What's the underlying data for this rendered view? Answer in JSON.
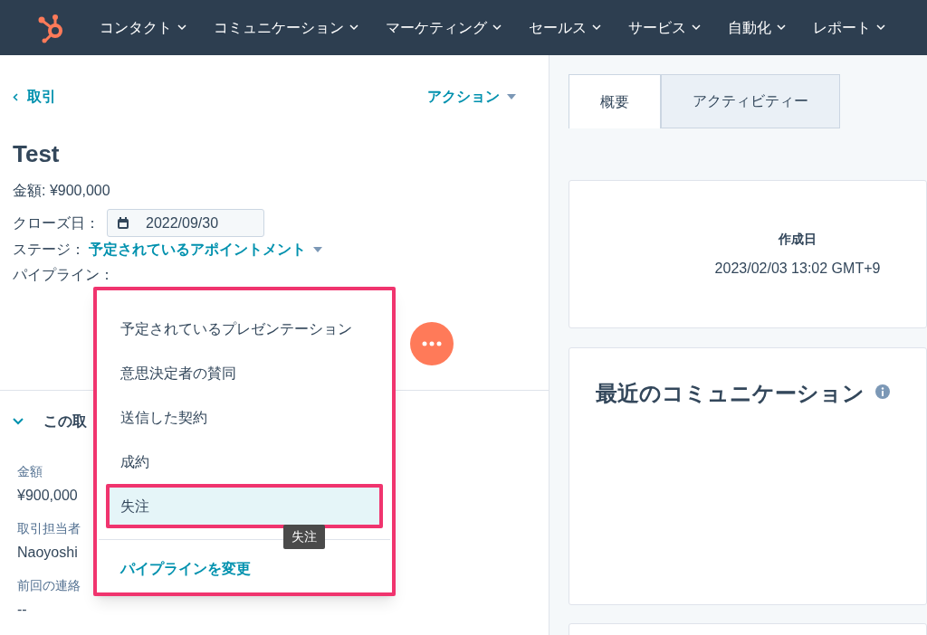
{
  "nav": {
    "items": [
      {
        "label": "コンタクト"
      },
      {
        "label": "コミュニケーション"
      },
      {
        "label": "マーケティング"
      },
      {
        "label": "セールス"
      },
      {
        "label": "サービス"
      },
      {
        "label": "自動化"
      },
      {
        "label": "レポート"
      }
    ]
  },
  "record": {
    "back": "取引",
    "actions": "アクション",
    "title": "Test",
    "amount": "金額: ¥900,000",
    "close_label": "クローズ日：",
    "close_date": "2022/09/30",
    "stage_label": "ステージ：",
    "stage_value": "予定されているアポイントメント",
    "pipeline_label": "パイプライン："
  },
  "about": {
    "heading": "この取",
    "expanded": true,
    "fields": [
      {
        "label": "金額",
        "value": "¥900,000"
      },
      {
        "label": "取引担当者",
        "value": "Naoyoshi"
      },
      {
        "label": "前回の連絡",
        "value": "--"
      }
    ]
  },
  "stage_menu": {
    "items": [
      {
        "label": "予定されているプレゼンテーション",
        "selected": false
      },
      {
        "label": "意思決定者の賛同",
        "selected": false
      },
      {
        "label": "送信した契約",
        "selected": false
      },
      {
        "label": "成約",
        "selected": false
      },
      {
        "label": "失注",
        "selected": true
      }
    ],
    "footer_link": "パイプラインを変更",
    "tooltip": "失注"
  },
  "tabs": [
    {
      "label": "概要",
      "selected": true
    },
    {
      "label": "アクティビティー",
      "selected": false
    }
  ],
  "created_card": {
    "label": "作成日",
    "value": "2023/02/03 13:02 GMT+9"
  },
  "communications_card": {
    "title": "最近のコミュニケーション"
  }
}
